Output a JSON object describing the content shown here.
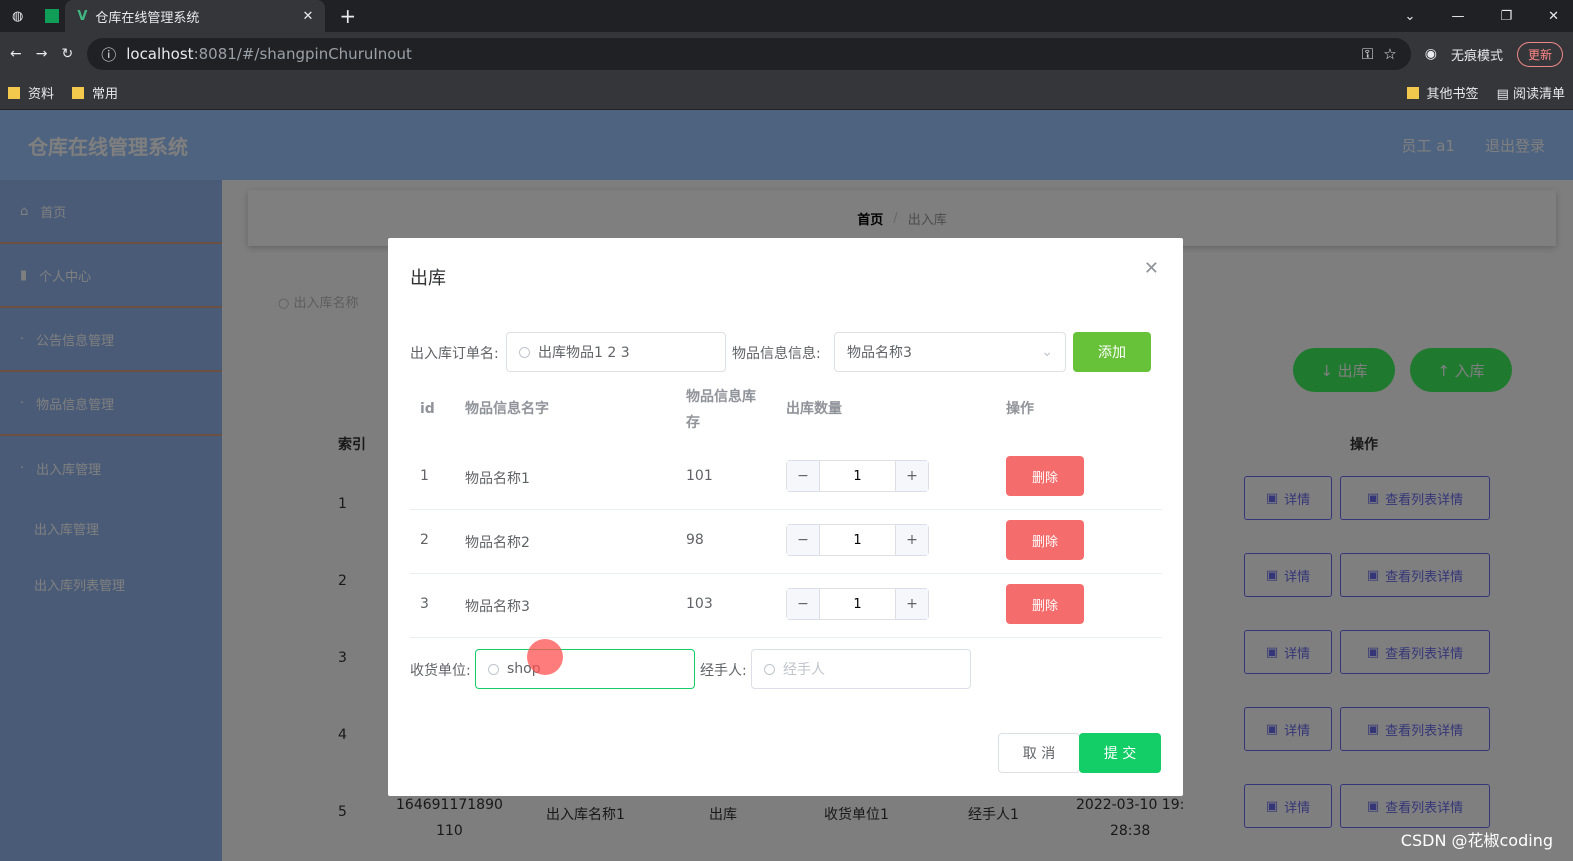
{
  "browser": {
    "tab_title": "仓库在线管理系统",
    "url_host": "localhost",
    "url_rest": ":8081/#/shangpinChuruInout",
    "incognito": "无痕模式",
    "update": "更新",
    "bookmarks": [
      "资料",
      "常用"
    ],
    "bookmarks_right": [
      "其他书签",
      "阅读清单"
    ]
  },
  "app": {
    "title": "仓库在线管理系统",
    "user": "员工 a1",
    "logout": "退出登录"
  },
  "sidebar": {
    "items": [
      {
        "label": "首页",
        "icon": "home-icon"
      },
      {
        "label": "个人中心",
        "icon": "user-icon"
      },
      {
        "label": "公告信息管理",
        "icon": "notice-icon"
      },
      {
        "label": "物品信息管理",
        "icon": "goods-icon"
      },
      {
        "label": "出入库管理",
        "icon": "warehouse-icon"
      }
    ],
    "subitems": [
      "出入库管理",
      "出入库列表管理"
    ]
  },
  "breadcrumb": {
    "home": "首页",
    "sep": "/",
    "current": "出入库"
  },
  "bg": {
    "search_placeholder": "出入库名称",
    "out_btn": "↓ 出库",
    "in_btn": "↑ 入库",
    "col_index": "索引",
    "col_ops": "操作",
    "detail": "详情",
    "list_detail": "查看列表详情",
    "row_indexes": [
      "1",
      "2",
      "3",
      "4",
      "5"
    ],
    "row5": {
      "id": "164691171890",
      "id2": "110",
      "name": "出入库名称1",
      "type": "出库",
      "unit": "收货单位1",
      "handler": "经手人1",
      "time": "2022-03-10 19:",
      "time2": "28:38"
    }
  },
  "modal": {
    "title": "出库",
    "order_label": "出入库订单名:",
    "order_value": "出库物品1 2 3",
    "goods_label": "物品信息信息:",
    "goods_value": "物品名称3",
    "add_btn": "添加",
    "headers": {
      "id": "id",
      "name": "物品信息名字",
      "stock": "物品信息库存",
      "qty": "出库数量",
      "ops": "操作"
    },
    "rows": [
      {
        "id": "1",
        "name": "物品名称1",
        "stock": "101",
        "qty": "1"
      },
      {
        "id": "2",
        "name": "物品名称2",
        "stock": "98",
        "qty": "1"
      },
      {
        "id": "3",
        "name": "物品名称3",
        "stock": "103",
        "qty": "1"
      }
    ],
    "delete_btn": "删除",
    "unit_label": "收货单位:",
    "unit_value": "shop",
    "handler_label": "经手人:",
    "handler_placeholder": "经手人",
    "cancel": "取 消",
    "submit": "提 交"
  },
  "watermark": "CSDN @花椒coding",
  "colors": {
    "primary": "#13ce66",
    "add": "#67c23a",
    "danger": "#f56c6c"
  }
}
